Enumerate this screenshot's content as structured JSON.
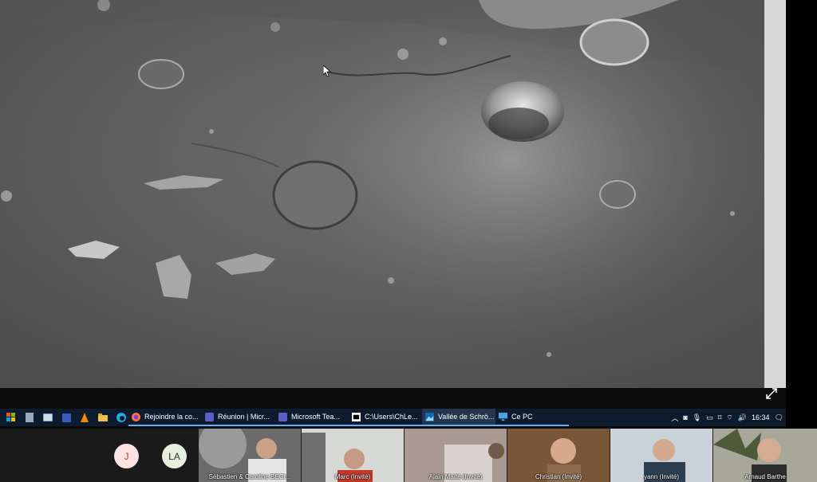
{
  "taskbar": {
    "items": [
      {
        "label": "Rejoindre la co...",
        "icon": "firefox-icon"
      },
      {
        "label": "Réunion | Micr...",
        "icon": "teams-icon"
      },
      {
        "label": "Microsoft Tea...",
        "icon": "teams-icon"
      },
      {
        "label": "C:\\Users\\ChLe...",
        "icon": "7zip-icon"
      },
      {
        "label": "Vallée de Schrö...",
        "icon": "image-viewer-icon"
      },
      {
        "label": "Ce PC",
        "icon": "computer-icon"
      }
    ],
    "clock": "16:34"
  },
  "participants": {
    "avatars": [
      {
        "initials": "J",
        "bg": "#fde2e2",
        "fg": "#c0392b"
      },
      {
        "initials": "LA",
        "bg": "#e6eedd",
        "fg": "#333333"
      }
    ],
    "tiles": [
      {
        "name": "Sébastien & Caroline BECI..."
      },
      {
        "name": "Marc (Invité)"
      },
      {
        "name": "Alain Maïté (Invité)"
      },
      {
        "name": "Christian (Invité)"
      },
      {
        "name": "yann (Invité)"
      },
      {
        "name": "Arnaud Barthe"
      }
    ]
  },
  "colors": {
    "taskbar": "#0e1b2e",
    "accent": "#5fb0ff"
  }
}
